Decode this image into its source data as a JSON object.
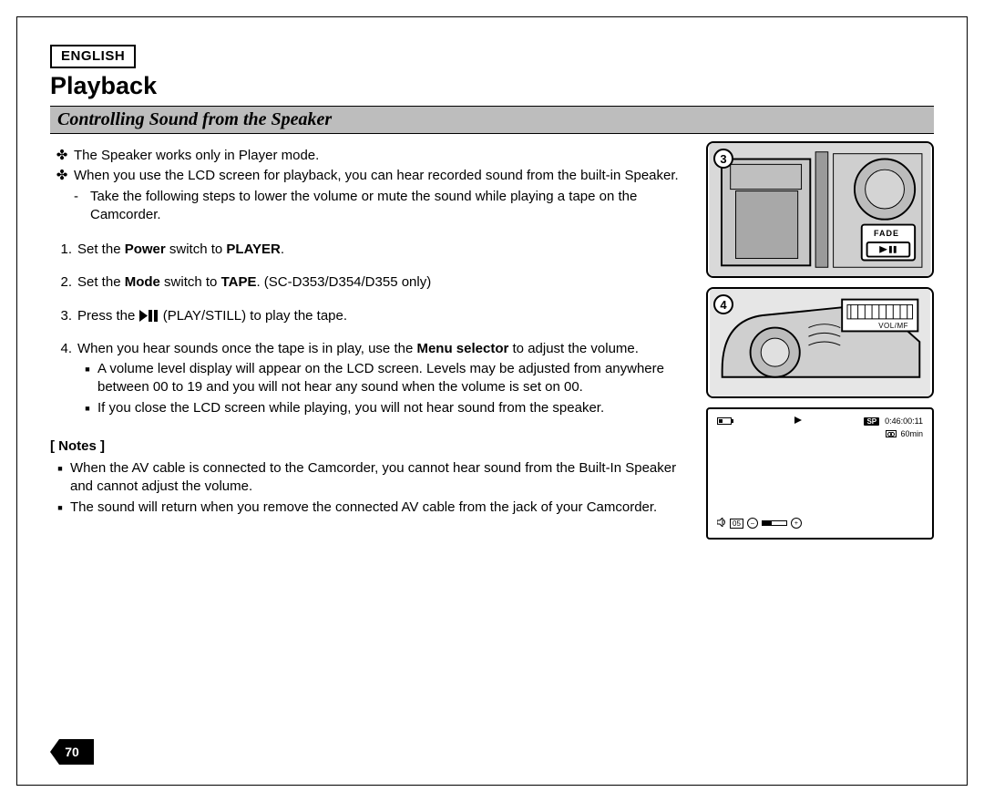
{
  "language": "ENGLISH",
  "title": "Playback",
  "section": "Controlling Sound from the Speaker",
  "intro": {
    "items": [
      {
        "text": "The Speaker works only in Player mode."
      },
      {
        "text": "When you use the LCD screen for playback, you can hear recorded sound from the built-in Speaker.",
        "sub": [
          "Take the following steps to lower the volume or mute the sound while playing a tape on the Camcorder."
        ]
      }
    ]
  },
  "steps": [
    {
      "n": "1.",
      "pre": "Set the ",
      "b1": "Power",
      "mid1": " switch to ",
      "b2": "PLAYER",
      "post": "."
    },
    {
      "n": "2.",
      "pre": "Set the ",
      "b1": "Mode",
      "mid1": " switch to ",
      "b2": "TAPE",
      "post": ". (SC-D353/D354/D355 only)"
    },
    {
      "n": "3.",
      "pre": "Press the ",
      "icon": "play-still",
      "post": " (PLAY/STILL) to play the tape."
    },
    {
      "n": "4.",
      "pre": "When you hear sounds once the tape is in play, use the ",
      "b1": "Menu selector",
      "post": " to adjust the volume.",
      "subs": [
        "A volume level display will appear on the LCD screen. Levels may be adjusted from anywhere between 00 to 19 and you will not hear any sound when the volume is set on 00.",
        "If you close the LCD screen while playing, you will not hear sound from the speaker."
      ]
    }
  ],
  "notes_header": "[ Notes ]",
  "notes": [
    "When the AV cable is connected to the Camcorder, you cannot hear sound from the Built-In Speaker and cannot adjust the volume.",
    "The sound will return when you remove the connected AV cable from the jack of your Camcorder."
  ],
  "figures": {
    "f3_badge": "3",
    "f3_fade": "FADE",
    "f4_badge": "4",
    "f4_label": "VOL/MF",
    "lcd": {
      "sp": "SP",
      "timecode": "0:46:00:11",
      "remain": "60min",
      "vol": "05"
    }
  },
  "page_number": "70"
}
